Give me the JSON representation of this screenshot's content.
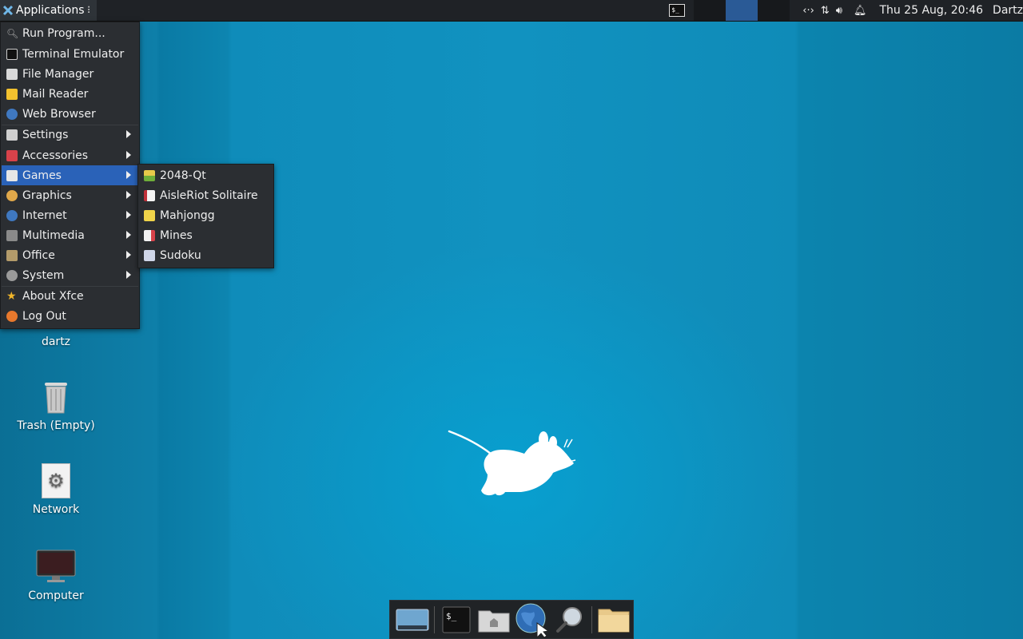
{
  "panel": {
    "applications_label": "Applications",
    "clock": "Thu 25 Aug, 20:46",
    "user": "Dartz"
  },
  "main_menu": {
    "items": [
      {
        "label": "Run Program...",
        "icon": "search-icon",
        "submenu": false
      },
      {
        "label": "Terminal Emulator",
        "icon": "terminal-icon",
        "submenu": false
      },
      {
        "label": "File Manager",
        "icon": "folder-icon",
        "submenu": false
      },
      {
        "label": "Mail Reader",
        "icon": "mail-icon",
        "submenu": false
      },
      {
        "label": "Web Browser",
        "icon": "globe-icon",
        "submenu": false
      },
      {
        "label": "Settings",
        "icon": "settings-icon",
        "submenu": true
      },
      {
        "label": "Accessories",
        "icon": "accessories-icon",
        "submenu": true
      },
      {
        "label": "Games",
        "icon": "games-icon",
        "submenu": true,
        "active": true
      },
      {
        "label": "Graphics",
        "icon": "palette-icon",
        "submenu": true
      },
      {
        "label": "Internet",
        "icon": "globe-icon",
        "submenu": true
      },
      {
        "label": "Multimedia",
        "icon": "multimedia-icon",
        "submenu": true
      },
      {
        "label": "Office",
        "icon": "office-icon",
        "submenu": true
      },
      {
        "label": "System",
        "icon": "gear-icon",
        "submenu": true
      },
      {
        "label": "About Xfce",
        "icon": "star-icon",
        "submenu": false
      },
      {
        "label": "Log Out",
        "icon": "logout-icon",
        "submenu": false
      }
    ]
  },
  "games_menu": {
    "items": [
      {
        "label": "2048-Qt",
        "icon": "2048-icon"
      },
      {
        "label": "AisleRiot Solitaire",
        "icon": "cards-icon"
      },
      {
        "label": "Mahjongg",
        "icon": "mahjongg-icon"
      },
      {
        "label": "Mines",
        "icon": "mines-icon"
      },
      {
        "label": "Sudoku",
        "icon": "sudoku-icon"
      }
    ]
  },
  "desktop_icons": [
    {
      "label": "dartz",
      "icon": "home-folder-icon"
    },
    {
      "label": "Trash (Empty)",
      "icon": "trash-icon"
    },
    {
      "label": "Network",
      "icon": "network-icon"
    },
    {
      "label": "Computer",
      "icon": "computer-icon"
    }
  ],
  "dock": {
    "items": [
      "show-desktop-icon",
      "terminal-icon",
      "home-folder-icon",
      "web-browser-icon",
      "app-finder-icon",
      "file-folder-icon"
    ]
  },
  "colors": {
    "panel_bg": "#1f2226",
    "menu_bg": "#2b2e32",
    "menu_highlight": "#2a62b8",
    "desktop_blue": "#0f8bb8"
  }
}
